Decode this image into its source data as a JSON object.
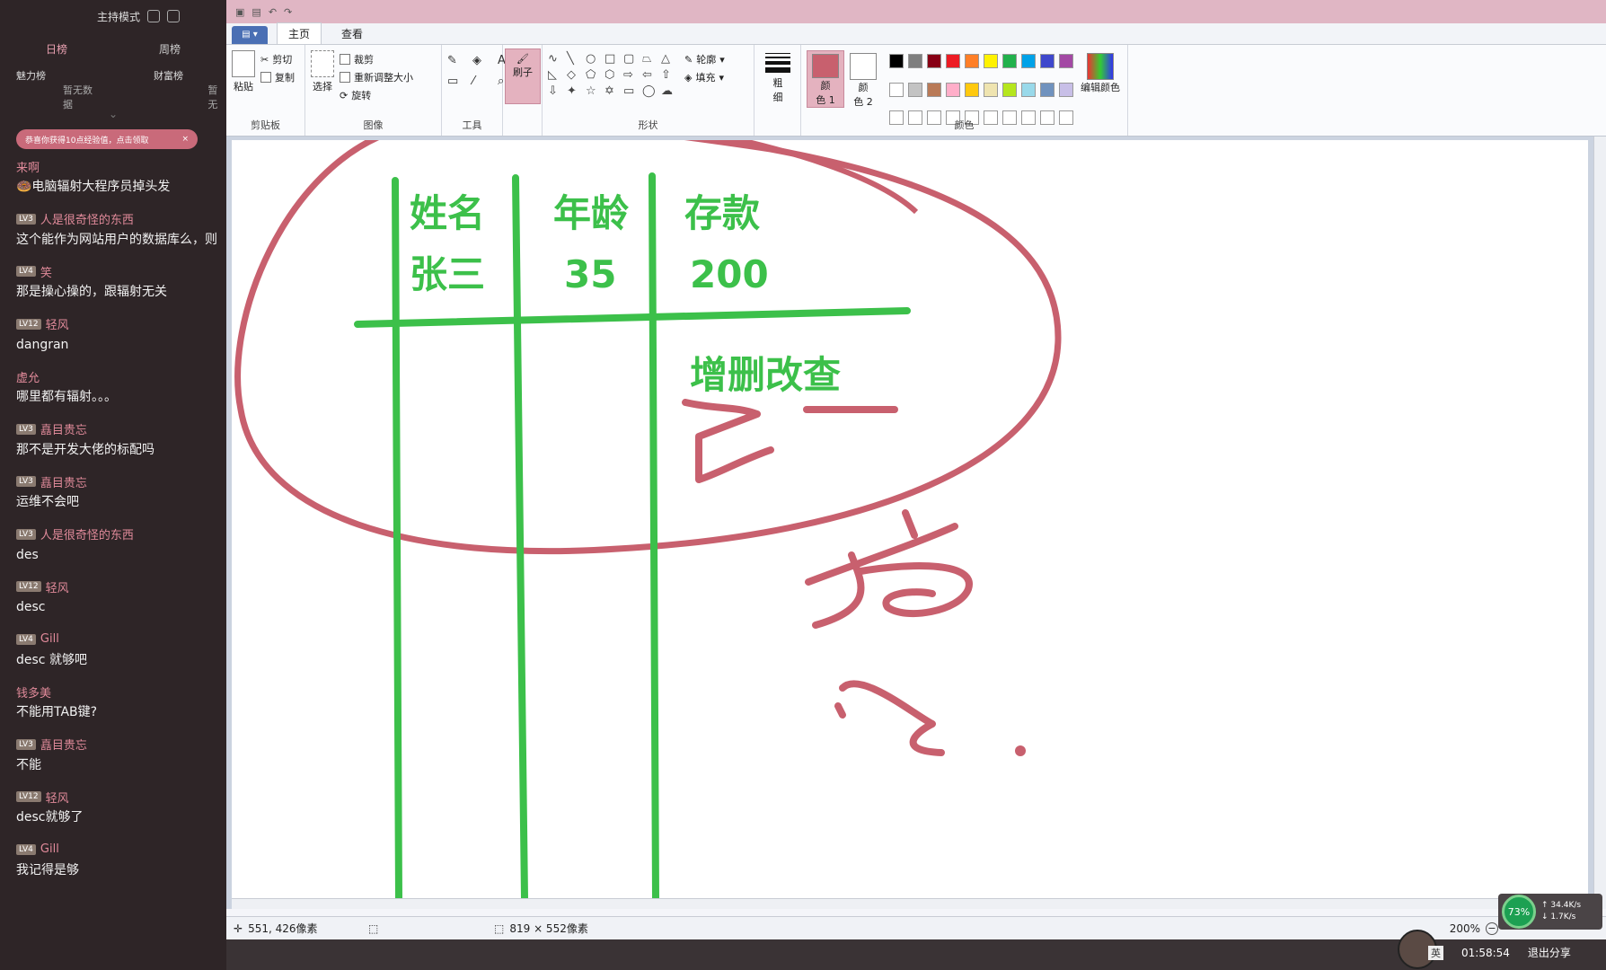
{
  "chat": {
    "host_mode": "主持模式",
    "tabs": [
      "日榜",
      "周榜"
    ],
    "ranks": [
      "魅力榜",
      "财富榜"
    ],
    "no_data": "暂无数据",
    "no_data2": "暂无",
    "notice": "恭喜你获得10点经验值，点击领取",
    "messages": [
      {
        "level": "",
        "user": "来啊",
        "text": "🍩电脑辐射大程序员掉头发"
      },
      {
        "level": "LV3",
        "user": "人是很奇怪的东西",
        "text": "这个能作为网站用户的数据库么，则"
      },
      {
        "level": "LV4",
        "user": "笑",
        "text": "那是操心操的，跟辐射无关"
      },
      {
        "level": "LV12",
        "user": "轻风",
        "text": "dangran"
      },
      {
        "level": "",
        "user": "虚允",
        "text": "哪里都有辐射。。。"
      },
      {
        "level": "LV3",
        "user": "嚞目贵忘",
        "text": "那不是开发大佬的标配吗"
      },
      {
        "level": "LV3",
        "user": "嚞目贵忘",
        "text": "运维不会吧"
      },
      {
        "level": "LV3",
        "user": "人是很奇怪的东西",
        "text": "des"
      },
      {
        "level": "LV12",
        "user": "轻风",
        "text": "desc"
      },
      {
        "level": "LV4",
        "user": "Gill",
        "text": "desc 就够吧"
      },
      {
        "level": "",
        "user": "钱多美",
        "text": "不能用TAB键?"
      },
      {
        "level": "LV3",
        "user": "嚞目贵忘",
        "text": "不能"
      },
      {
        "level": "LV12",
        "user": "轻风",
        "text": "desc就够了"
      },
      {
        "level": "LV4",
        "user": "Gill",
        "text": "我记得是够"
      }
    ]
  },
  "paint": {
    "ribbon_tabs": [
      "主页",
      "查看"
    ],
    "clipboard": {
      "paste": "粘贴",
      "cut": "剪切",
      "copy": "复制",
      "label": "剪贴板"
    },
    "image": {
      "select": "选择",
      "crop": "裁剪",
      "resize": "重新调整大小",
      "rotate": "旋转",
      "label": "图像"
    },
    "tools": {
      "label": "工具"
    },
    "brush": {
      "label": "刷子"
    },
    "shapes": {
      "outline": "轮廓",
      "fill": "填充",
      "label": "形状"
    },
    "size": {
      "label": "粗\n细"
    },
    "color1": {
      "label": "颜\n色 1",
      "value": "#c8606e"
    },
    "color2": {
      "label": "颜\n色 2",
      "value": "#ffffff"
    },
    "edit_colors": "编辑颜色",
    "colors_label": "颜色",
    "palette": [
      "#000000",
      "#7f7f7f",
      "#880015",
      "#ed1c24",
      "#ff7f27",
      "#fff200",
      "#22b14c",
      "#00a2e8",
      "#3f48cc",
      "#a349a4",
      "#ffffff",
      "#c3c3c3",
      "#b97a57",
      "#ffaec9",
      "#ffc90e",
      "#efe4b0",
      "#b5e61d",
      "#99d9ea",
      "#7092be",
      "#c8bfe7"
    ],
    "status": {
      "cursor": "551, 426像素",
      "size": "819 × 552像素",
      "zoom": "200%"
    }
  },
  "drawing": {
    "headers": [
      "姓名",
      "年龄",
      "存款"
    ],
    "row": [
      "张三",
      "35",
      "200"
    ],
    "crud": "增删改查",
    "line_color": "#3cc04a",
    "ink_color": "#c8606e"
  },
  "overlay": {
    "cpu": "73%",
    "up": "34.4K/s",
    "down": "1.7K/s",
    "lang": "英",
    "time": "01:58:54",
    "exit_share": "退出分享"
  }
}
